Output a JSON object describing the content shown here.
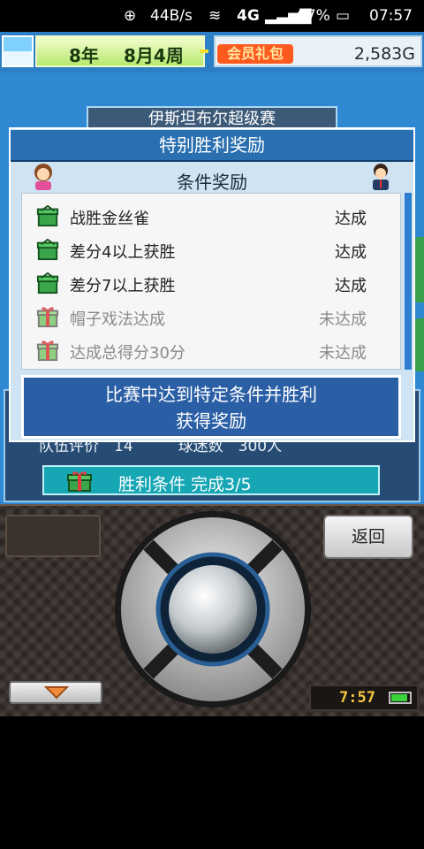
{
  "status_bar": {
    "speed": "44B/s",
    "network": "4G",
    "battery": "67%",
    "time": "07:57"
  },
  "top_bar": {
    "year": "8年",
    "month_week": "8月4周",
    "vip_label": "会员礼包",
    "money": "2,583G"
  },
  "background": {
    "tournament_title": "伊斯坦布尔超级赛",
    "team_stats": "队伍评价　14　　　球迷数　300人",
    "win_conditions": "胜利条件  完成3/5"
  },
  "dialog": {
    "title": "特别胜利奖励",
    "subtitle": "条件奖励",
    "conditions": [
      {
        "name": "战胜金丝雀",
        "status": "达成",
        "achieved": true
      },
      {
        "name": "差分4以上获胜",
        "status": "达成",
        "achieved": true
      },
      {
        "name": "差分7以上获胜",
        "status": "达成",
        "achieved": true
      },
      {
        "name": "帽子戏法达成",
        "status": "未达成",
        "achieved": false
      },
      {
        "name": "达成总得分30分",
        "status": "未达成",
        "achieved": false
      }
    ],
    "description_line1": "比赛中达到特定条件并胜利",
    "description_line2": "获得奖励"
  },
  "controls": {
    "back_label": "返回",
    "clock": "7:57"
  },
  "icons": {
    "gift_achieved": "green-gift-box-icon",
    "gift_unachieved": "red-gift-box-icon"
  },
  "colors": {
    "achieved_text": "#222222",
    "unachieved_text": "#8b8b8b",
    "accent": "#2a6fb0"
  }
}
